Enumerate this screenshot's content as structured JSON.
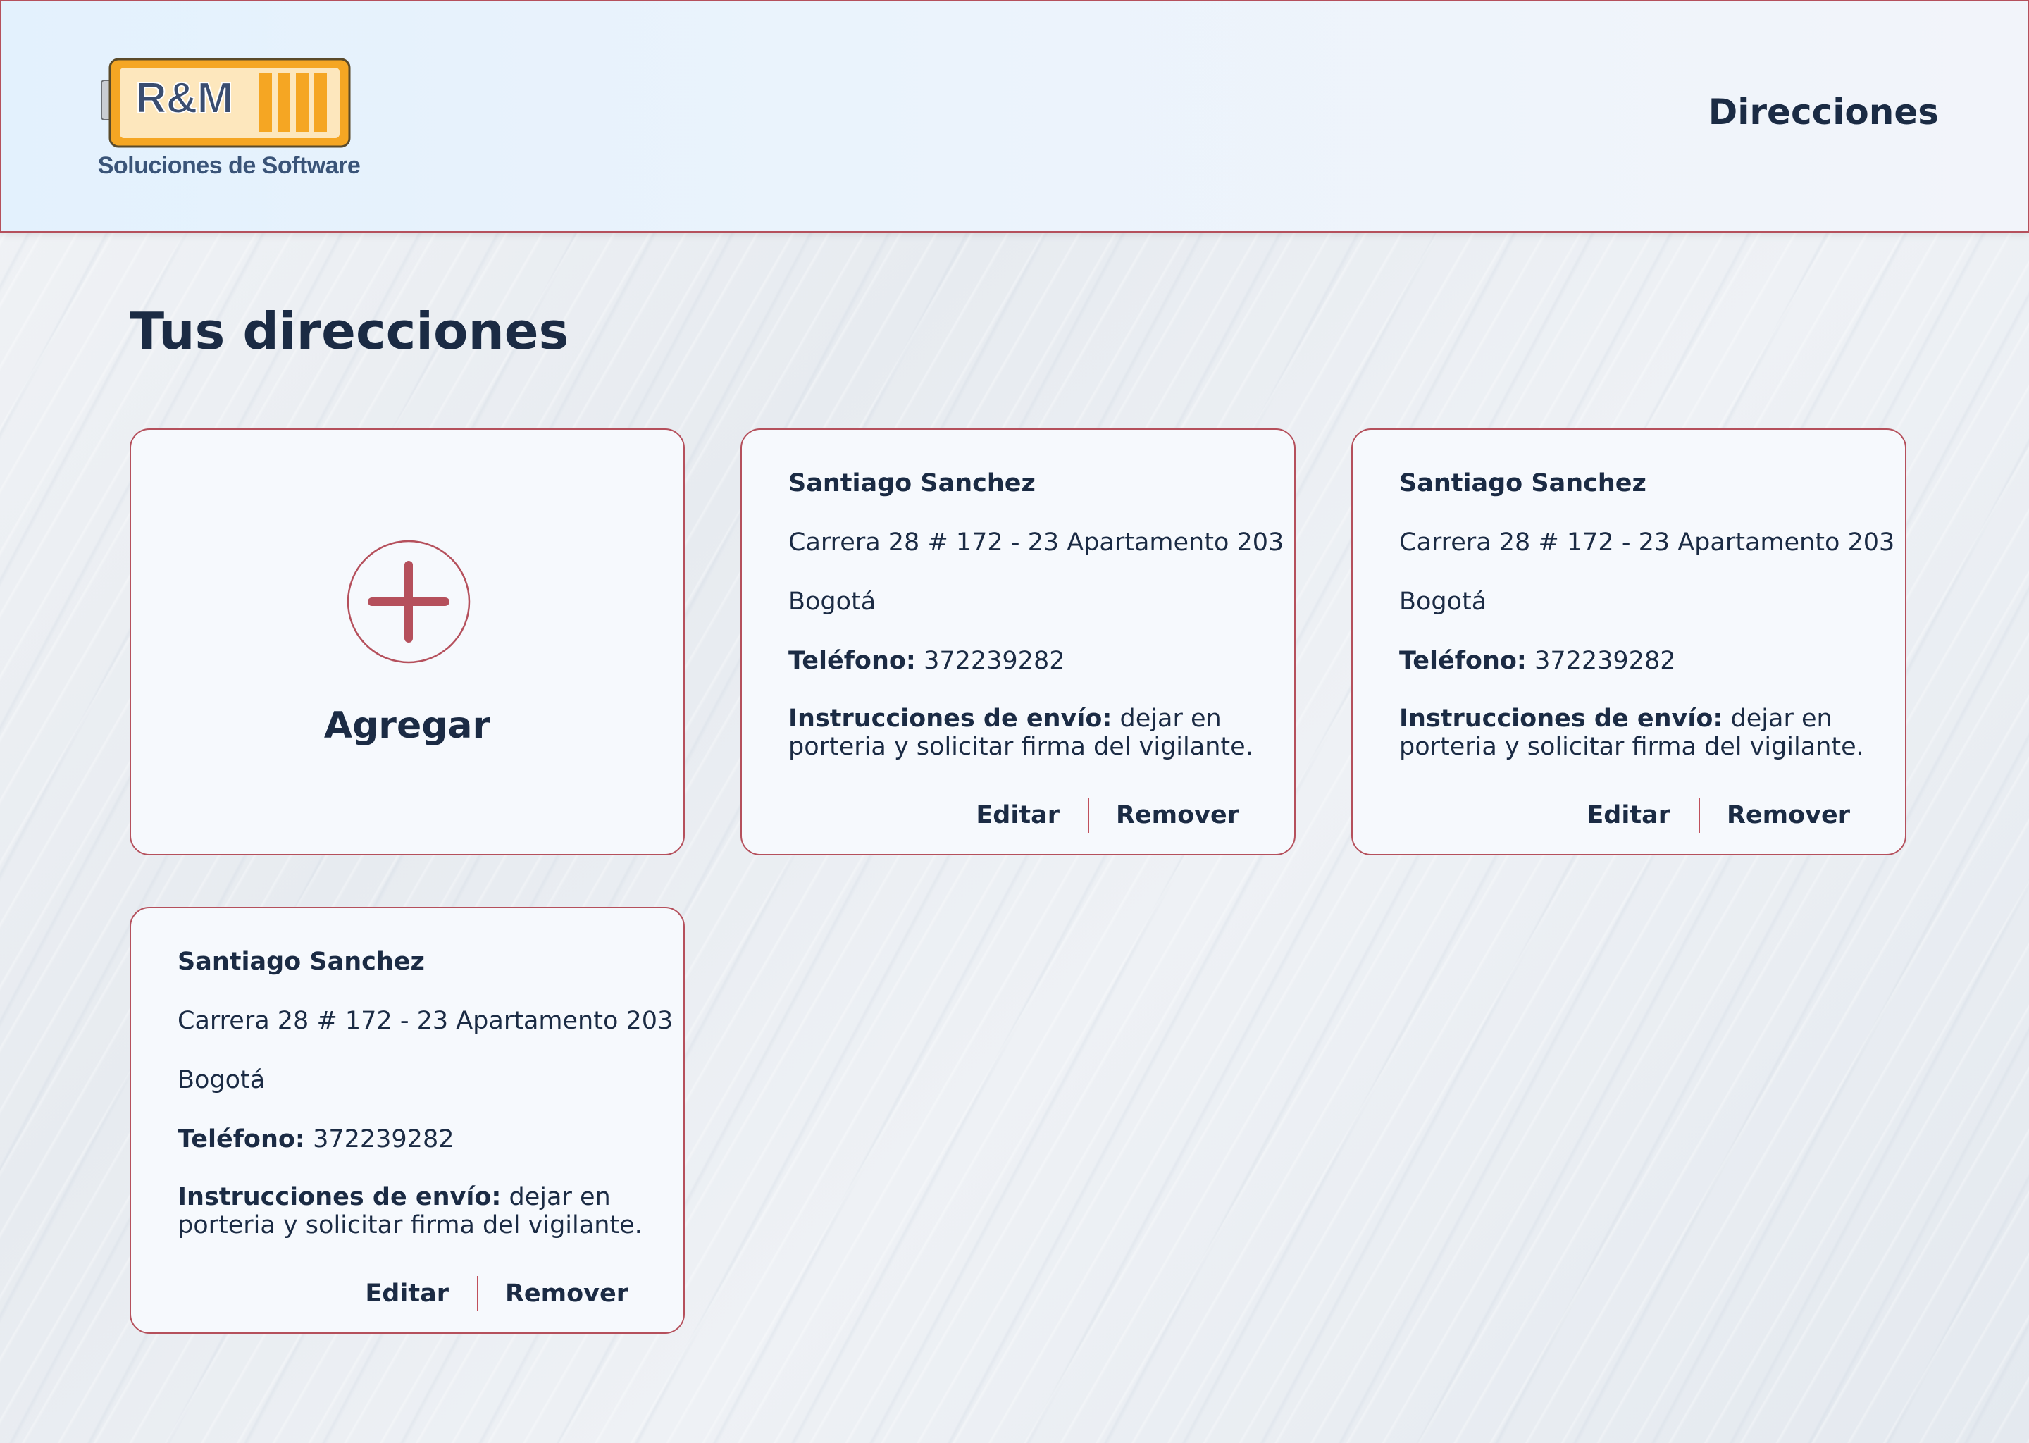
{
  "header": {
    "logo_text": "R&M",
    "logo_caption": "Soluciones de Software",
    "title": "Direcciones"
  },
  "page": {
    "title": "Tus direcciones"
  },
  "add_card": {
    "label": "Agregar",
    "icon": "plus-circle-icon"
  },
  "addresses": [
    {
      "name": "Santiago Sanchez",
      "street": "Carrera 28 # 172 - 23 Apartamento 203",
      "city": "Bogotá",
      "phone_label": "Teléfono:",
      "phone": "372239282",
      "instructions_label": "Instrucciones de envío:",
      "instructions": "dejar en porteria y solicitar firma del vigilante.",
      "edit_label": "Editar",
      "remove_label": "Remover"
    },
    {
      "name": "Santiago Sanchez",
      "street": "Carrera 28 # 172 - 23 Apartamento 203",
      "city": "Bogotá",
      "phone_label": "Teléfono:",
      "phone": "372239282",
      "instructions_label": "Instrucciones de envío:",
      "instructions": "dejar en porteria y solicitar firma del vigilante.",
      "edit_label": "Editar",
      "remove_label": "Remover"
    },
    {
      "name": "Santiago Sanchez",
      "street": "Carrera 28 # 172 - 23 Apartamento 203",
      "city": "Bogotá",
      "phone_label": "Teléfono:",
      "phone": "372239282",
      "instructions_label": "Instrucciones de envío:",
      "instructions": "dejar en porteria y solicitar firma del vigilante.",
      "edit_label": "Editar",
      "remove_label": "Remover"
    }
  ],
  "colors": {
    "accent": "#b5505c",
    "text": "#1b2b44",
    "card_bg": "#f6f9fd",
    "logo_orange": "#f5a623"
  }
}
